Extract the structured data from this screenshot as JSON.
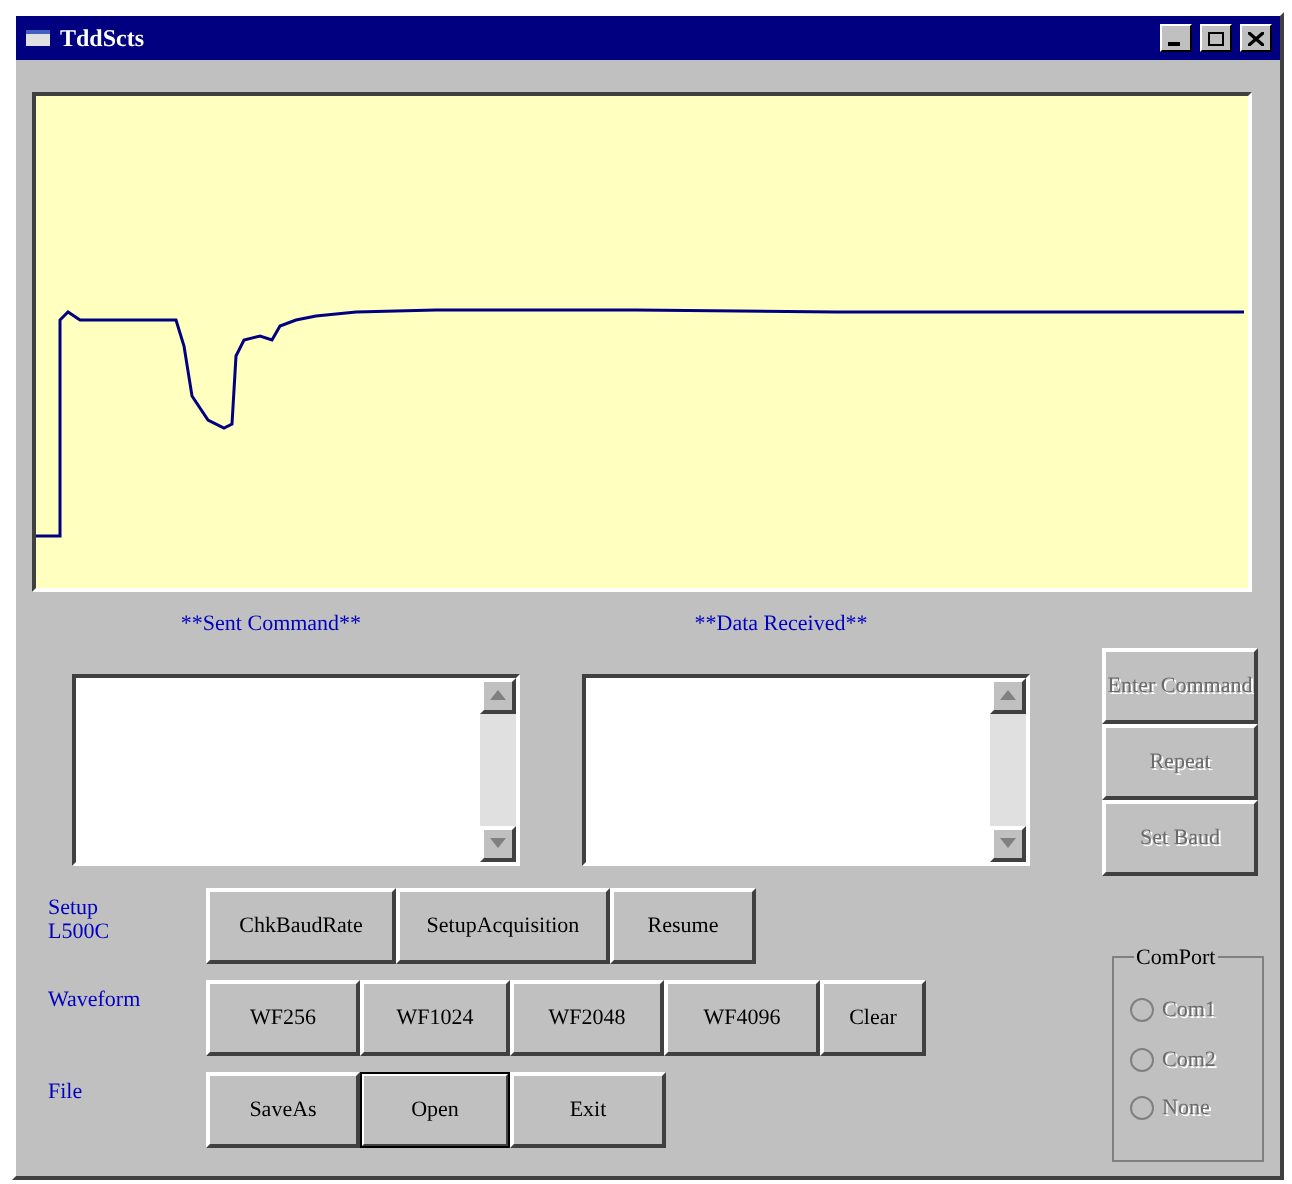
{
  "window": {
    "title": "TddScts"
  },
  "labels": {
    "sent": "**Sent Command**",
    "received": "**Data Received**"
  },
  "side_buttons": [
    {
      "label": "Enter Command",
      "disabled": true
    },
    {
      "label": "Repeat",
      "disabled": true
    },
    {
      "label": "Set Baud",
      "disabled": true
    }
  ],
  "rows": [
    {
      "label": "Setup L500C",
      "buttons": [
        {
          "label": "ChkBaudRate",
          "default": false
        },
        {
          "label": "SetupAcquisition",
          "default": false
        },
        {
          "label": "Resume",
          "default": false
        }
      ]
    },
    {
      "label": "Waveform",
      "buttons": [
        {
          "label": "WF256",
          "default": false
        },
        {
          "label": "WF1024",
          "default": false
        },
        {
          "label": "WF2048",
          "default": false
        },
        {
          "label": "WF4096",
          "default": false
        },
        {
          "label": "Clear",
          "default": false
        }
      ]
    },
    {
      "label": "File",
      "buttons": [
        {
          "label": "SaveAs",
          "default": false
        },
        {
          "label": "Open",
          "default": true
        },
        {
          "label": "Exit",
          "default": false
        }
      ]
    }
  ],
  "comport": {
    "title": "ComPort",
    "options": [
      {
        "label": "Com1",
        "selected": false,
        "disabled": true
      },
      {
        "label": "Com2",
        "selected": false,
        "disabled": true
      },
      {
        "label": "None",
        "selected": false,
        "disabled": true
      }
    ]
  }
}
